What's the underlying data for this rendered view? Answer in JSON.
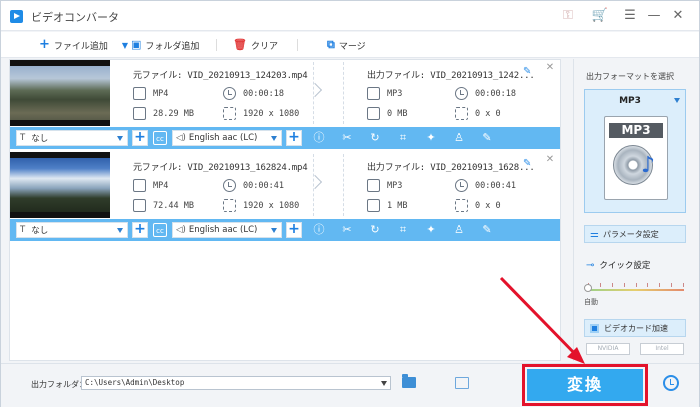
{
  "window": {
    "title": "ビデオコンバータ"
  },
  "toolbar": {
    "add_file": "ファイル追加",
    "add_folder": "フォルダ追加",
    "clear": "クリア",
    "merge": "マージ"
  },
  "files": [
    {
      "source_name": "元ファイル: VID_20210913_124203.mp4",
      "source_format": "MP4",
      "source_duration": "00:00:18",
      "source_size": "28.29 MB",
      "source_resolution": "1920 x 1080",
      "output_name": "出力ファイル: VID_20210913_1242...",
      "output_format": "MP3",
      "output_duration": "00:00:18",
      "output_size": "0 MB",
      "output_resolution": "0 x 0",
      "subtitle": "なし",
      "audio": "English aac (LC)"
    },
    {
      "source_name": "元ファイル: VID_20210913_162824.mp4",
      "source_format": "MP4",
      "source_duration": "00:00:41",
      "source_size": "72.44 MB",
      "source_resolution": "1920 x 1080",
      "output_name": "出力ファイル: VID_20210913_1628...",
      "output_format": "MP3",
      "output_duration": "00:00:41",
      "output_size": "1 MB",
      "output_resolution": "0 x 0",
      "subtitle": "なし",
      "audio": "English aac (LC)"
    }
  ],
  "format_panel": {
    "title": "出力フォーマットを選択",
    "selected": "MP3",
    "icon_text": "MP3",
    "param_settings": "パラメータ設定",
    "quick_settings": "クイック設定",
    "auto_label": "自動",
    "gpu_accel": "ビデオカード加速",
    "vendors": [
      "NVIDIA",
      "Intel"
    ]
  },
  "bottom": {
    "output_folder_label": "出力フォルダ：",
    "output_folder_path": "C:\\Users\\Admin\\Desktop",
    "convert": "変換"
  },
  "colors": {
    "accent": "#33a9ef",
    "control_bar": "#62b8f2",
    "highlight": "#e3122b"
  }
}
